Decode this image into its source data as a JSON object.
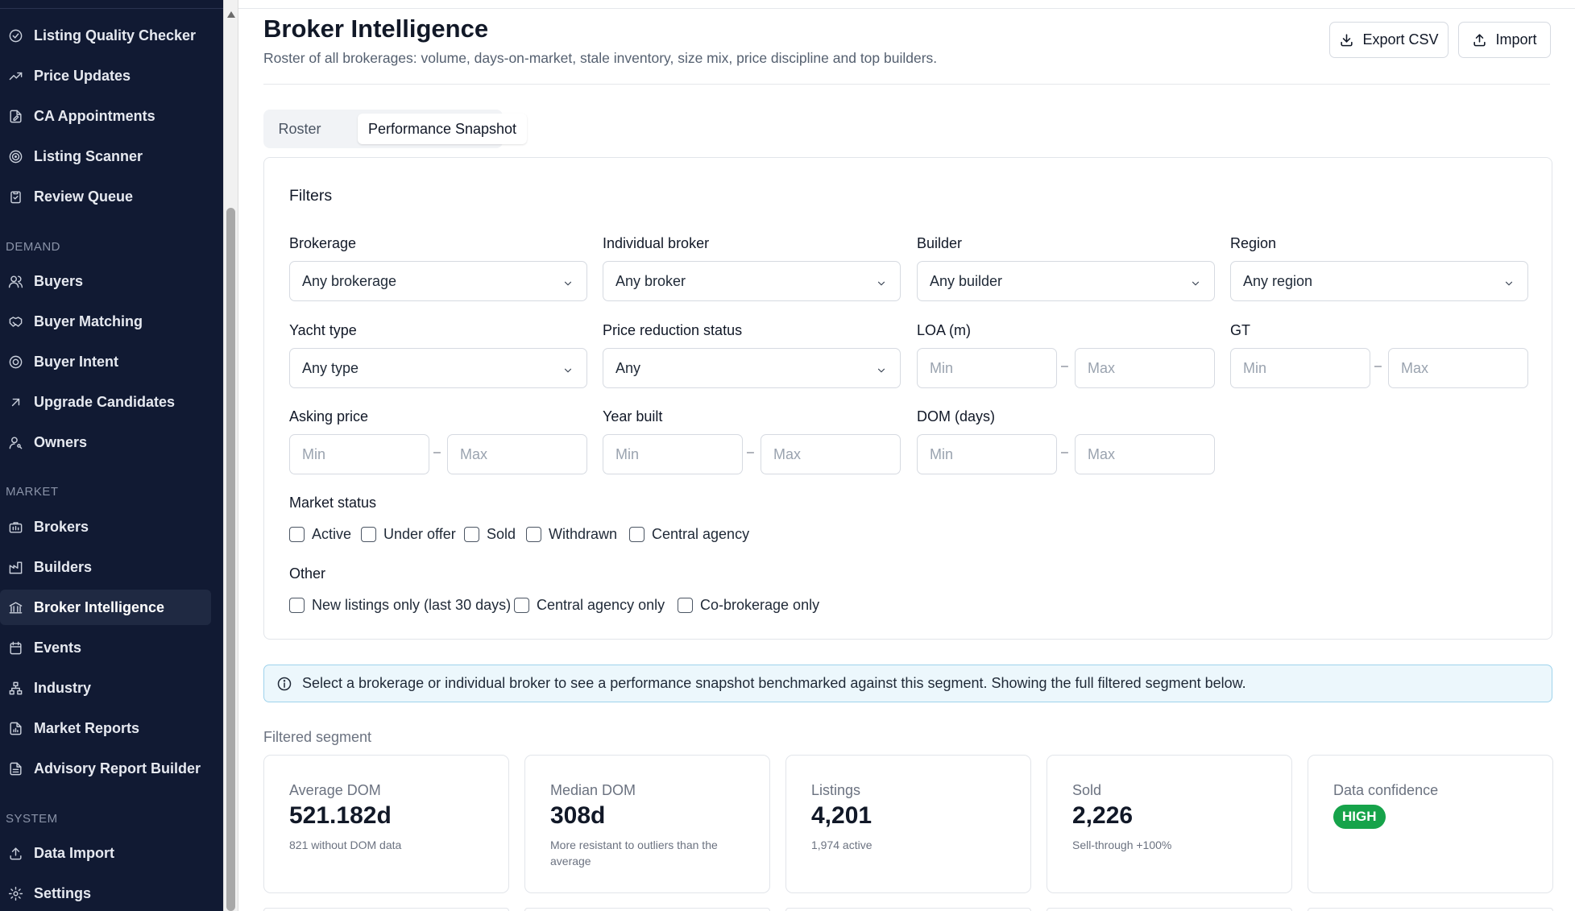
{
  "sidebar": {
    "items_top": [
      {
        "label": "Listing Quality Checker",
        "icon": "check-circle-icon"
      },
      {
        "label": "Price Updates",
        "icon": "trending-up-icon"
      },
      {
        "label": "CA Appointments",
        "icon": "file-edit-icon"
      },
      {
        "label": "Listing Scanner",
        "icon": "target-icon"
      },
      {
        "label": "Review Queue",
        "icon": "clipboard-check-icon"
      }
    ],
    "sections": [
      {
        "title": "DEMAND",
        "items": [
          {
            "label": "Buyers",
            "icon": "users-icon"
          },
          {
            "label": "Buyer Matching",
            "icon": "handshake-icon"
          },
          {
            "label": "Buyer Intent",
            "icon": "radar-icon"
          },
          {
            "label": "Upgrade Candidates",
            "icon": "arrow-up-right-icon"
          },
          {
            "label": "Owners",
            "icon": "user-key-icon"
          }
        ]
      },
      {
        "title": "MARKET",
        "items": [
          {
            "label": "Brokers",
            "icon": "briefcase-icon"
          },
          {
            "label": "Builders",
            "icon": "factory-icon"
          },
          {
            "label": "Broker Intelligence",
            "icon": "landmark-icon",
            "active": true
          },
          {
            "label": "Events",
            "icon": "calendar-icon"
          },
          {
            "label": "Industry",
            "icon": "network-icon"
          },
          {
            "label": "Market Reports",
            "icon": "file-chart-icon"
          },
          {
            "label": "Advisory Report Builder",
            "icon": "file-text-icon"
          }
        ]
      },
      {
        "title": "SYSTEM",
        "items": [
          {
            "label": "Data Import",
            "icon": "upload-icon"
          },
          {
            "label": "Settings",
            "icon": "gear-icon"
          }
        ]
      }
    ]
  },
  "header": {
    "title": "Broker Intelligence",
    "subtitle": "Roster of all brokerages: volume, days-on-market, stale inventory, size mix, price discipline and top builders.",
    "export_label": "Export CSV",
    "import_label": "Import"
  },
  "tabs": [
    {
      "label": "Roster",
      "active": false
    },
    {
      "label": "Performance Snapshot",
      "active": true
    }
  ],
  "filters": {
    "title": "Filters",
    "brokerage": {
      "label": "Brokerage",
      "value": "Any brokerage"
    },
    "broker": {
      "label": "Individual broker",
      "value": "Any broker"
    },
    "builder": {
      "label": "Builder",
      "value": "Any builder"
    },
    "region": {
      "label": "Region",
      "value": "Any region"
    },
    "yacht_type": {
      "label": "Yacht type",
      "value": "Any type"
    },
    "price_reduction": {
      "label": "Price reduction status",
      "value": "Any"
    },
    "loa": {
      "label": "LOA (m)",
      "min_placeholder": "Min",
      "max_placeholder": "Max"
    },
    "gt": {
      "label": "GT",
      "min_placeholder": "Min",
      "max_placeholder": "Max"
    },
    "asking_price": {
      "label": "Asking price",
      "min_placeholder": "Min",
      "max_placeholder": "Max"
    },
    "year_built": {
      "label": "Year built",
      "min_placeholder": "Min",
      "max_placeholder": "Max"
    },
    "dom": {
      "label": "DOM (days)",
      "min_placeholder": "Min",
      "max_placeholder": "Max"
    },
    "range_separator": "–",
    "market_status": {
      "label": "Market status",
      "options": [
        "Active",
        "Under offer",
        "Sold",
        "Withdrawn",
        "Central agency"
      ]
    },
    "other": {
      "label": "Other",
      "options": [
        "New listings only (last 30 days)",
        "Central agency only",
        "Co-brokerage only"
      ]
    }
  },
  "banner": {
    "text": "Select a brokerage or individual broker to see a performance snapshot benchmarked against this segment. Showing the full filtered segment below."
  },
  "segment": {
    "label": "Filtered segment",
    "stats": [
      {
        "label": "Average DOM",
        "value": "521.182d",
        "sub": "821 without DOM data"
      },
      {
        "label": "Median DOM",
        "value": "308d",
        "sub": "More resistant to outliers than the average"
      },
      {
        "label": "Listings",
        "value": "4,201",
        "sub": "1,974 active"
      },
      {
        "label": "Sold",
        "value": "2,226",
        "sub": "Sell-through +100%"
      },
      {
        "label": "Data confidence",
        "badge": "HIGH",
        "badge_color": "#16a34a"
      }
    ]
  },
  "colors": {
    "sidebar_bg": "#111a33",
    "sidebar_active": "#1f2942",
    "banner_bg": "#ecf7fc",
    "badge_green": "#16a34a"
  }
}
